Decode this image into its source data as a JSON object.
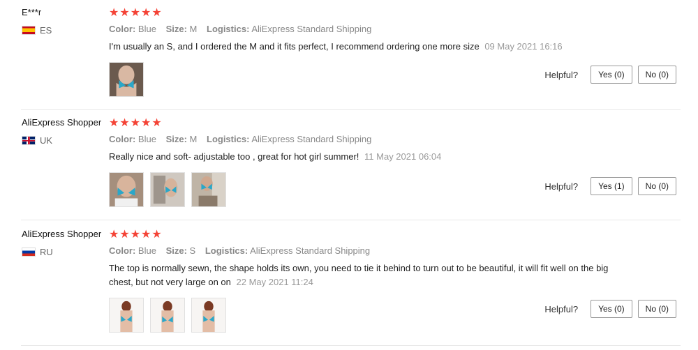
{
  "labels": {
    "color": "Color:",
    "size": "Size:",
    "logistics": "Logistics:",
    "helpful": "Helpful?",
    "stars": "★★★★★"
  },
  "reviews": [
    {
      "user": "E***r",
      "country": "ES",
      "rating": 5,
      "color": "Blue",
      "size": "M",
      "logistics": "AliExpress Standard Shipping",
      "text": "I'm usually an S, and I ordered the M and it fits perfect, I recommend ordering one more size",
      "date": "09 May 2021 16:16",
      "yes": "Yes (0)",
      "no": "No (0)"
    },
    {
      "user": "AliExpress Shopper",
      "country": "UK",
      "rating": 5,
      "color": "Blue",
      "size": "M",
      "logistics": "AliExpress Standard Shipping",
      "text": "Really nice and soft- adjustable too , great for hot girl summer!",
      "date": "11 May 2021 06:04",
      "yes": "Yes (1)",
      "no": "No (0)"
    },
    {
      "user": "AliExpress Shopper",
      "country": "RU",
      "rating": 5,
      "color": "Blue",
      "size": "S",
      "logistics": "AliExpress Standard Shipping",
      "text": "The top is normally sewn, the shape holds its own, you need to tie it behind to turn out to be beautiful, it will fit well on the big chest, but not very large on on",
      "date": "22 May 2021 11:24",
      "yes": "Yes (0)",
      "no": "No (0)"
    }
  ],
  "colors": {
    "star": "#f44336",
    "muted": "#888888",
    "date": "#999999",
    "divider": "#e8e8e8"
  }
}
